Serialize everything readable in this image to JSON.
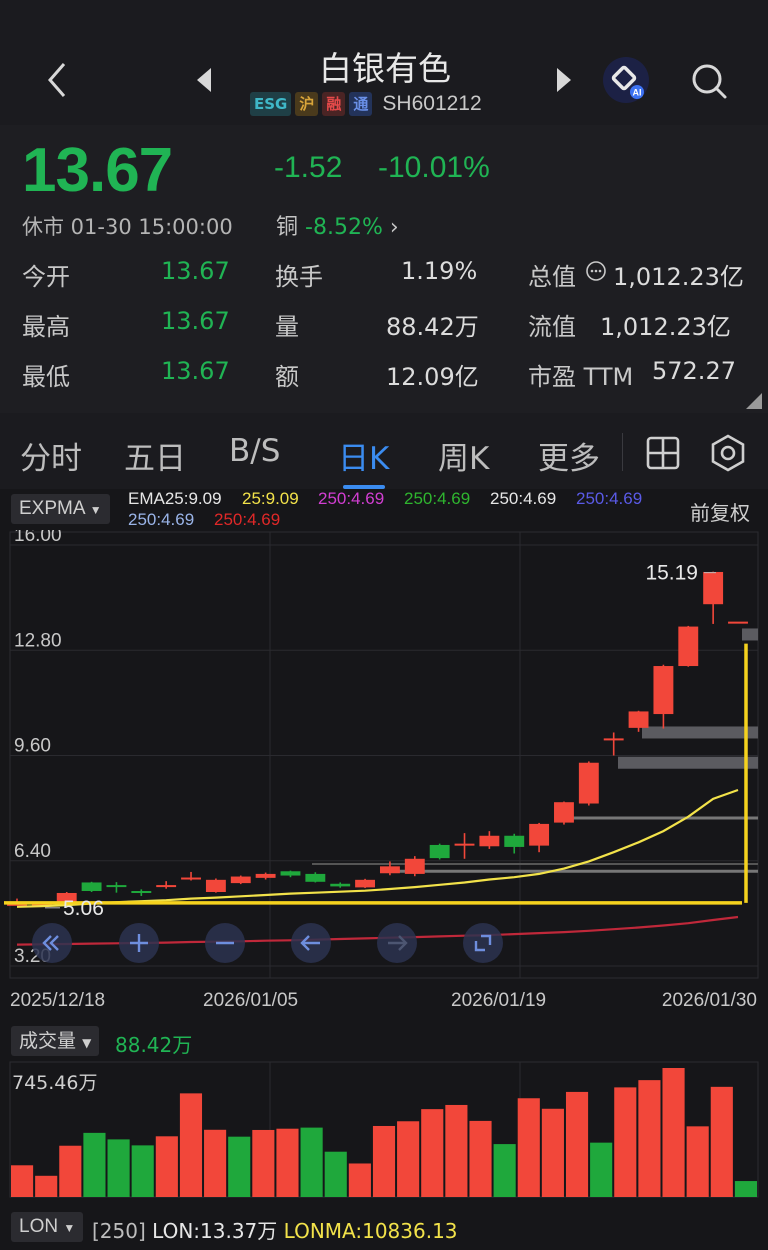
{
  "header": {
    "title": "白银有色",
    "tags": [
      "ESG",
      "沪",
      "融",
      "通"
    ],
    "code": "SH601212"
  },
  "quote": {
    "price": "13.67",
    "change": "-1.52",
    "change_pct": "-10.01%",
    "status": "休市 01-30 15:00:00",
    "related_label": "铜",
    "related_change": "-8.52%",
    "rows": [
      {
        "l1": "今开",
        "v1": "13.67",
        "l2": "换手",
        "v2": "1.19%",
        "l3": "总值",
        "v3": "1,012.23亿"
      },
      {
        "l1": "最高",
        "v1": "13.67",
        "l2": "量",
        "v2": "88.42万",
        "l3": "流值",
        "v3": "1,012.23亿"
      },
      {
        "l1": "最低",
        "v1": "13.67",
        "l2": "额",
        "v2": "12.09亿",
        "l3": "市盈 TTM",
        "v3": "572.27"
      }
    ]
  },
  "tabs": [
    "分时",
    "五日",
    "B/S",
    "日K",
    "周K",
    "更多"
  ],
  "active_tab": "日K",
  "indicator": {
    "name": "EXPMA",
    "ema_main": "EMA25:9.09",
    "ema_items": [
      {
        "text": "25:9.09",
        "color": "#f2e24a"
      },
      {
        "text": "250:4.69",
        "color": "#d23ed2"
      },
      {
        "text": "250:4.69",
        "color": "#2fb52f"
      },
      {
        "text": "250:4.69",
        "color": "#e6e6e6"
      },
      {
        "text": "250:4.69",
        "color": "#5a5ae6"
      }
    ],
    "ema_items2": [
      {
        "text": "250:4.69",
        "color": "#9ab4e8"
      },
      {
        "text": "250:4.69",
        "color": "#e02828"
      }
    ],
    "adjust": "前复权"
  },
  "chart_data": {
    "type": "candlestick",
    "y_ticks": [
      "16.00",
      "12.80",
      "9.60",
      "6.40",
      "3.20"
    ],
    "ylim": [
      3.2,
      16.0
    ],
    "x_labels": [
      "2025/12/18",
      "2026/01/05",
      "2026/01/19",
      "2026/01/30"
    ],
    "high_label": "15.19",
    "low_label": "5.06",
    "candles": [
      {
        "o": 5.07,
        "c": 5.09,
        "h": 5.25,
        "l": 5.06
      },
      {
        "o": 5.07,
        "c": 5.08,
        "h": 5.12,
        "l": 5.03
      },
      {
        "o": 5.08,
        "c": 5.42,
        "h": 5.45,
        "l": 5.05
      },
      {
        "o": 5.74,
        "c": 5.48,
        "h": 5.76,
        "l": 5.45
      },
      {
        "o": 5.66,
        "c": 5.62,
        "h": 5.75,
        "l": 5.43
      },
      {
        "o": 5.48,
        "c": 5.42,
        "h": 5.53,
        "l": 5.33
      },
      {
        "o": 5.62,
        "c": 5.66,
        "h": 5.78,
        "l": 5.55
      },
      {
        "o": 5.85,
        "c": 5.89,
        "h": 6.06,
        "l": 5.8
      },
      {
        "o": 5.45,
        "c": 5.82,
        "h": 5.86,
        "l": 5.43
      },
      {
        "o": 5.72,
        "c": 5.92,
        "h": 5.95,
        "l": 5.69
      },
      {
        "o": 5.88,
        "c": 6.0,
        "h": 6.04,
        "l": 5.83
      },
      {
        "o": 6.08,
        "c": 5.95,
        "h": 6.1,
        "l": 5.9
      },
      {
        "o": 6.0,
        "c": 5.76,
        "h": 6.05,
        "l": 5.74
      },
      {
        "o": 5.7,
        "c": 5.62,
        "h": 5.74,
        "l": 5.58
      },
      {
        "o": 5.59,
        "c": 5.82,
        "h": 5.85,
        "l": 5.57
      },
      {
        "o": 6.02,
        "c": 6.23,
        "h": 6.38,
        "l": 5.96
      },
      {
        "o": 6.0,
        "c": 6.46,
        "h": 6.54,
        "l": 5.93
      },
      {
        "o": 6.88,
        "c": 6.48,
        "h": 6.92,
        "l": 6.44
      },
      {
        "o": 6.88,
        "c": 6.92,
        "h": 7.24,
        "l": 6.46
      },
      {
        "o": 6.84,
        "c": 7.16,
        "h": 7.3,
        "l": 6.76
      },
      {
        "o": 7.16,
        "c": 6.82,
        "h": 7.22,
        "l": 6.62
      },
      {
        "o": 6.86,
        "c": 7.52,
        "h": 7.55,
        "l": 6.66
      },
      {
        "o": 7.56,
        "c": 8.18,
        "h": 8.2,
        "l": 7.5
      },
      {
        "o": 8.14,
        "c": 9.38,
        "h": 9.42,
        "l": 8.08
      },
      {
        "o": 10.08,
        "c": 10.12,
        "h": 10.3,
        "l": 9.6
      },
      {
        "o": 10.44,
        "c": 10.94,
        "h": 10.96,
        "l": 10.32
      },
      {
        "o": 10.86,
        "c": 12.32,
        "h": 12.36,
        "l": 10.42
      },
      {
        "o": 12.32,
        "c": 13.52,
        "h": 13.54,
        "l": 12.3
      },
      {
        "o": 14.2,
        "c": 15.18,
        "h": 15.19,
        "l": 13.6
      },
      {
        "o": 13.67,
        "c": 13.67,
        "h": 13.67,
        "l": 13.67
      }
    ],
    "ema25": [
      5.0,
      5.02,
      5.05,
      5.1,
      5.14,
      5.17,
      5.2,
      5.25,
      5.28,
      5.32,
      5.36,
      5.4,
      5.43,
      5.46,
      5.49,
      5.54,
      5.6,
      5.67,
      5.74,
      5.83,
      5.9,
      6.0,
      6.16,
      6.38,
      6.66,
      6.96,
      7.3,
      7.74,
      8.28,
      8.55
    ],
    "ema250": [
      3.85,
      3.86,
      3.87,
      3.88,
      3.89,
      3.9,
      3.91,
      3.93,
      3.94,
      3.95,
      3.97,
      3.98,
      4.0,
      4.02,
      4.04,
      4.06,
      4.08,
      4.1,
      4.12,
      4.14,
      4.17,
      4.2,
      4.23,
      4.27,
      4.32,
      4.37,
      4.43,
      4.5,
      4.6,
      4.69
    ],
    "horizontal_levels": [
      5.06,
      5.12,
      6.08,
      6.3,
      7.7,
      9.38,
      10.3,
      13.28
    ],
    "volume": {
      "label": "成交量",
      "current": "88.42万",
      "max_label": "745.46万",
      "values": [
        175,
        117,
        283,
        354,
        318,
        285,
        335,
        572,
        371,
        333,
        370,
        377,
        383,
        250,
        185,
        392,
        418,
        485,
        508,
        420,
        292,
        545,
        487,
        580,
        300,
        605,
        645,
        712,
        390,
        608,
        88
      ]
    },
    "lon": {
      "label": "LON",
      "param": "[250]",
      "lon": "LON:13.37万",
      "lonma": "LONMA:10836.13"
    }
  }
}
